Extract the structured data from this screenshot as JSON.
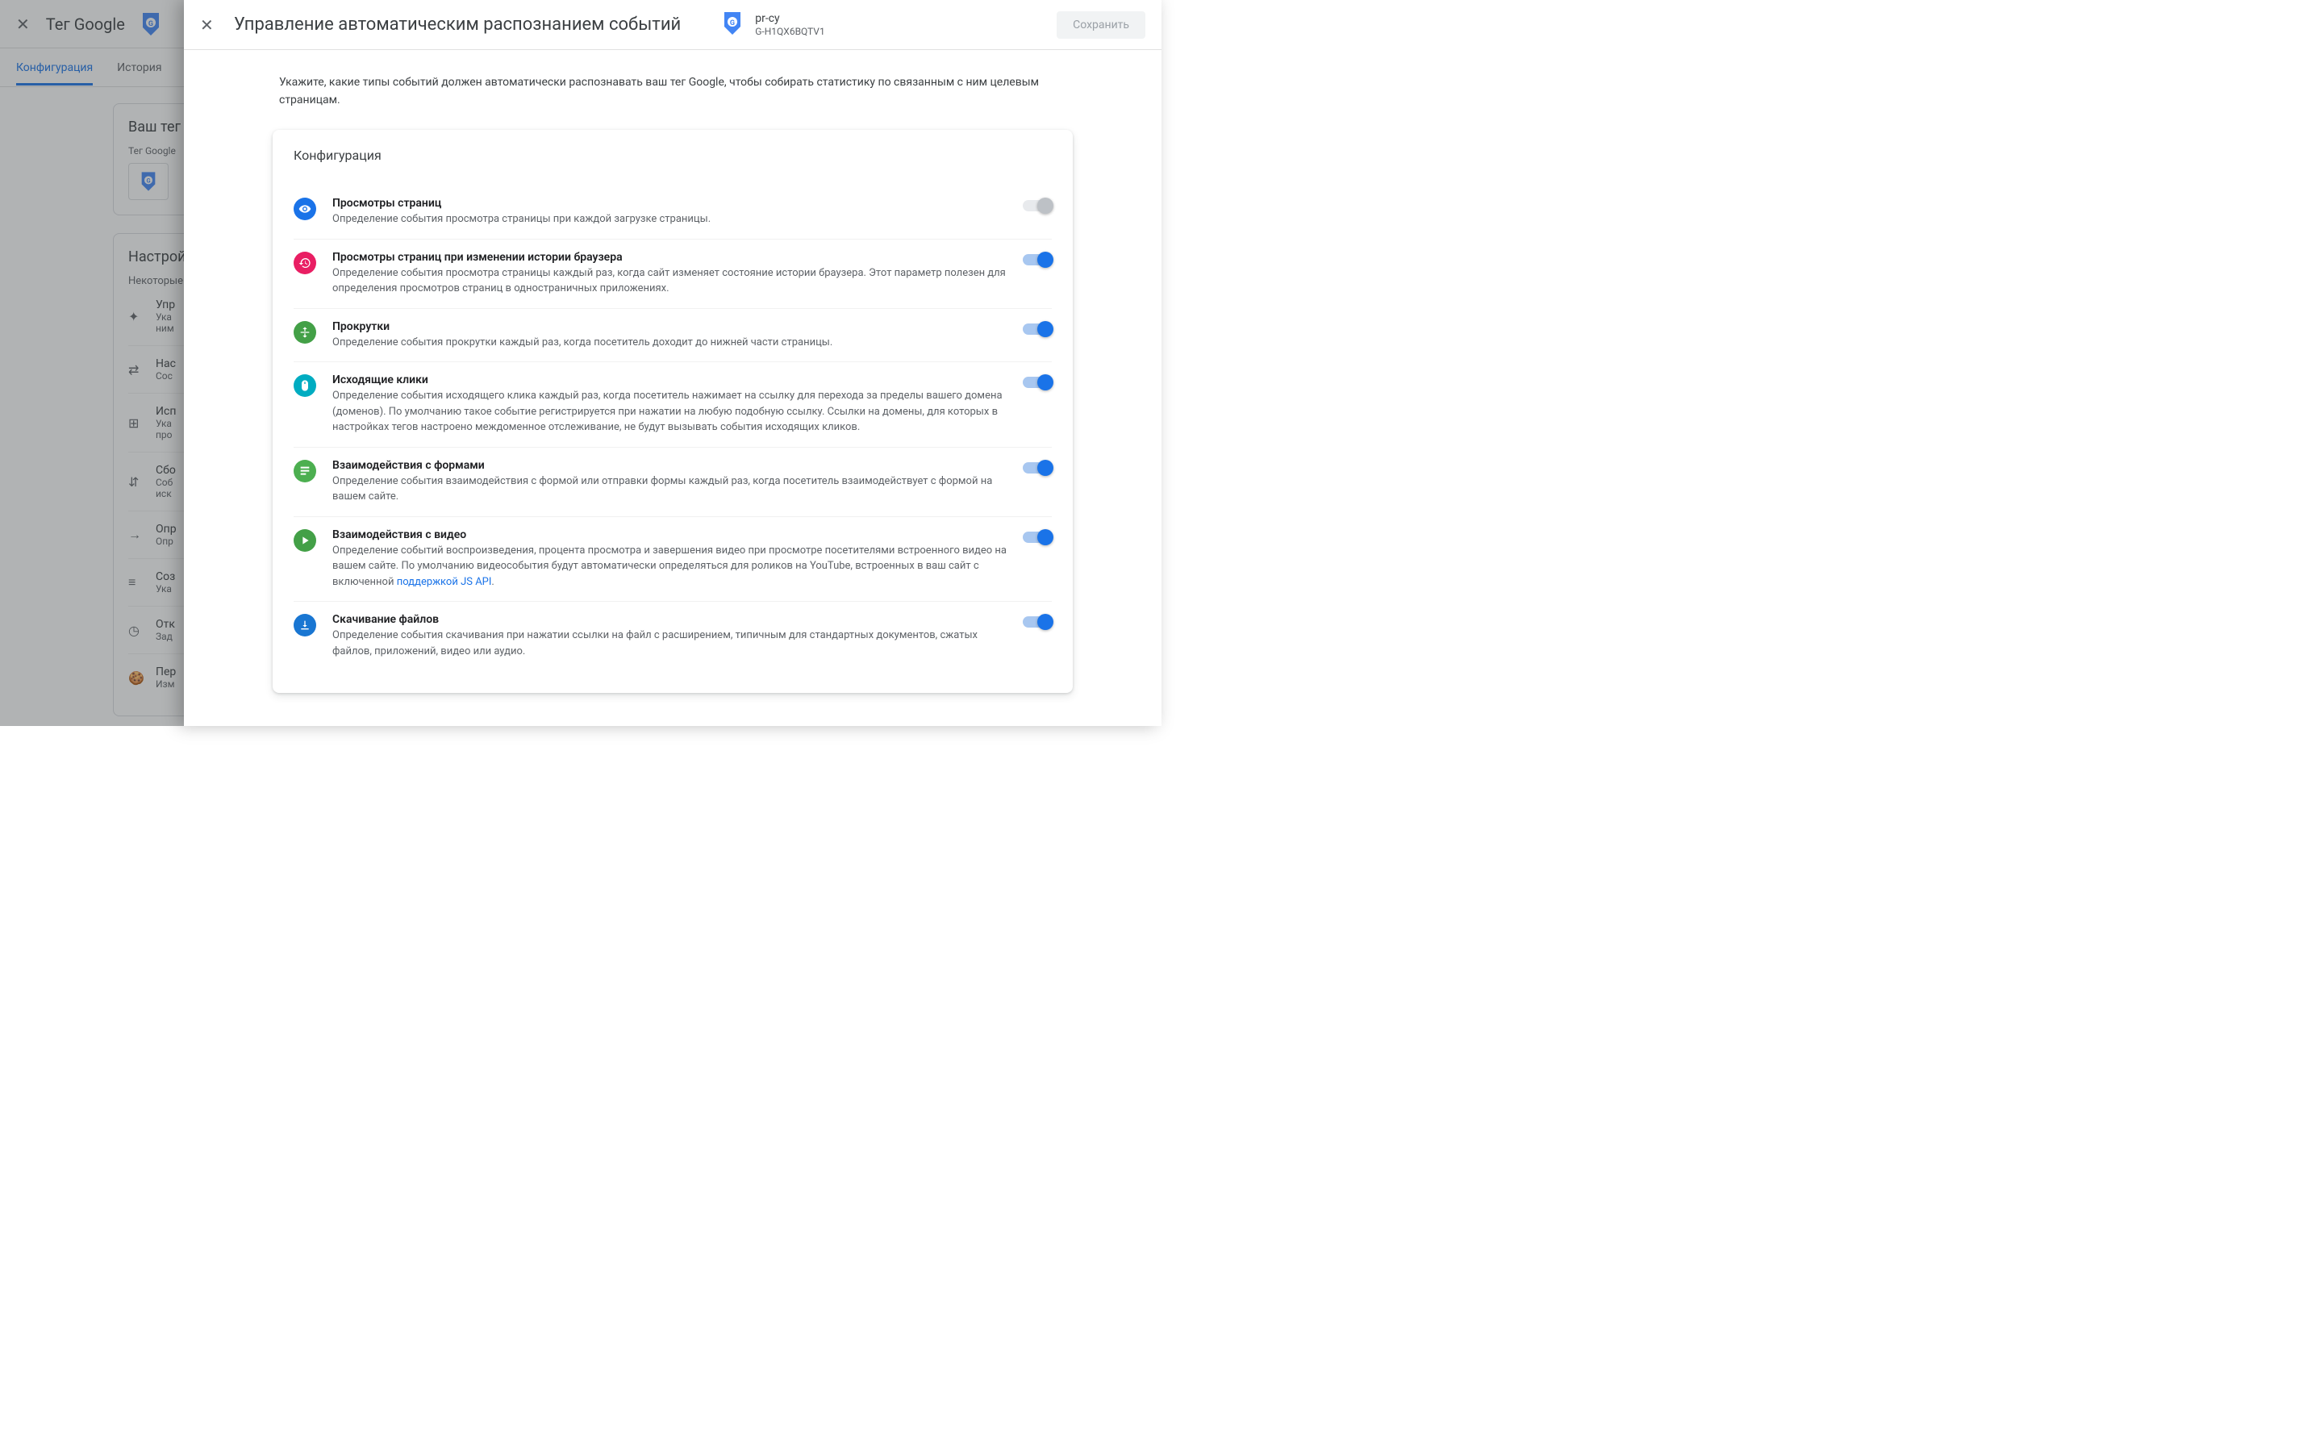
{
  "bgPage": {
    "title": "Тег Google",
    "tabs": {
      "config": "Конфигурация",
      "history": "История"
    },
    "card1": {
      "title": "Ваш тег G",
      "tagLabel": "Тег Google"
    },
    "card2": {
      "title": "Настройк",
      "sub": "Некоторые н"
    },
    "settingsRows": [
      {
        "t": "Упр",
        "s": "Ука\nним"
      },
      {
        "t": "Нас",
        "s": "Сос"
      },
      {
        "t": "Исп",
        "s": "Ука\nпро"
      },
      {
        "t": "Сбо",
        "s": "Соб\nиск"
      },
      {
        "t": "Опр",
        "s": "Опр"
      },
      {
        "t": "Соз",
        "s": "Ука"
      },
      {
        "t": "Отк",
        "s": "Зад"
      },
      {
        "t": "Пер",
        "s": "Изм"
      }
    ]
  },
  "modal": {
    "title": "Управление автоматическим распознанием событий",
    "property": {
      "name": "pr-cy",
      "id": "G-H1QX6BQTV1"
    },
    "saveLabel": "Сохранить",
    "description": "Укажите, какие типы событий должен автоматически распознавать ваш тег Google, чтобы собирать статистику по связанным с ним целевым страницам.",
    "configTitle": "Конфигурация",
    "events": [
      {
        "key": "page_view",
        "iconColor": "c-blue",
        "icon": "eye",
        "title": "Просмотры страниц",
        "desc": "Определение события просмотра страницы при каждой загрузке страницы.",
        "toggle": "disabled"
      },
      {
        "key": "history_change",
        "iconColor": "c-pink",
        "icon": "history",
        "title": "Просмотры страниц при изменении истории браузера",
        "desc": "Определение события просмотра страницы каждый раз, когда сайт изменяет состояние истории браузера. Этот параметр полезен для определения просмотров страниц в одностраничных приложениях.",
        "toggle": "on"
      },
      {
        "key": "scroll",
        "iconColor": "c-green",
        "icon": "scroll",
        "title": "Прокрутки",
        "desc": "Определение события прокрутки каждый раз, когда посетитель доходит до нижней части страницы.",
        "toggle": "on"
      },
      {
        "key": "outbound",
        "iconColor": "c-cyan",
        "icon": "mouse",
        "title": "Исходящие клики",
        "desc": "Определение события исходящего клика каждый раз, когда посетитель нажимает на ссылку для перехода за пределы вашего домена (доменов). По умолчанию такое событие регистрируется при нажатии на любую подобную ссылку. Ссылки на домены, для которых в настройках тегов настроено междоменное отслеживание, не будут вызывать события исходящих кликов.",
        "toggle": "on"
      },
      {
        "key": "forms",
        "iconColor": "c-green2",
        "icon": "form",
        "title": "Взаимодействия с формами",
        "desc": "Определение события взаимодействия с формой или отправки формы каждый раз, когда посетитель взаимодействует с формой на вашем сайте.",
        "toggle": "on"
      },
      {
        "key": "video",
        "iconColor": "c-green",
        "icon": "play",
        "title": "Взаимодействия с видео",
        "desc": "Определение событий воспроизведения, процента просмотра и завершения видео при просмотре посетителями встроенного видео на вашем сайте. По умолчанию видеособытия будут автоматически определяться для роликов на YouTube, встроенных в ваш сайт с включенной ",
        "linkText": "поддержкой JS API",
        "descAfter": ".",
        "toggle": "on"
      },
      {
        "key": "download",
        "iconColor": "c-dblue",
        "icon": "download",
        "title": "Скачивание файлов",
        "desc": "Определение события скачивания при нажатии ссылки на файл с расширением, типичным для стандартных документов, сжатых файлов, приложений, видео или аудио.",
        "toggle": "on"
      }
    ]
  }
}
